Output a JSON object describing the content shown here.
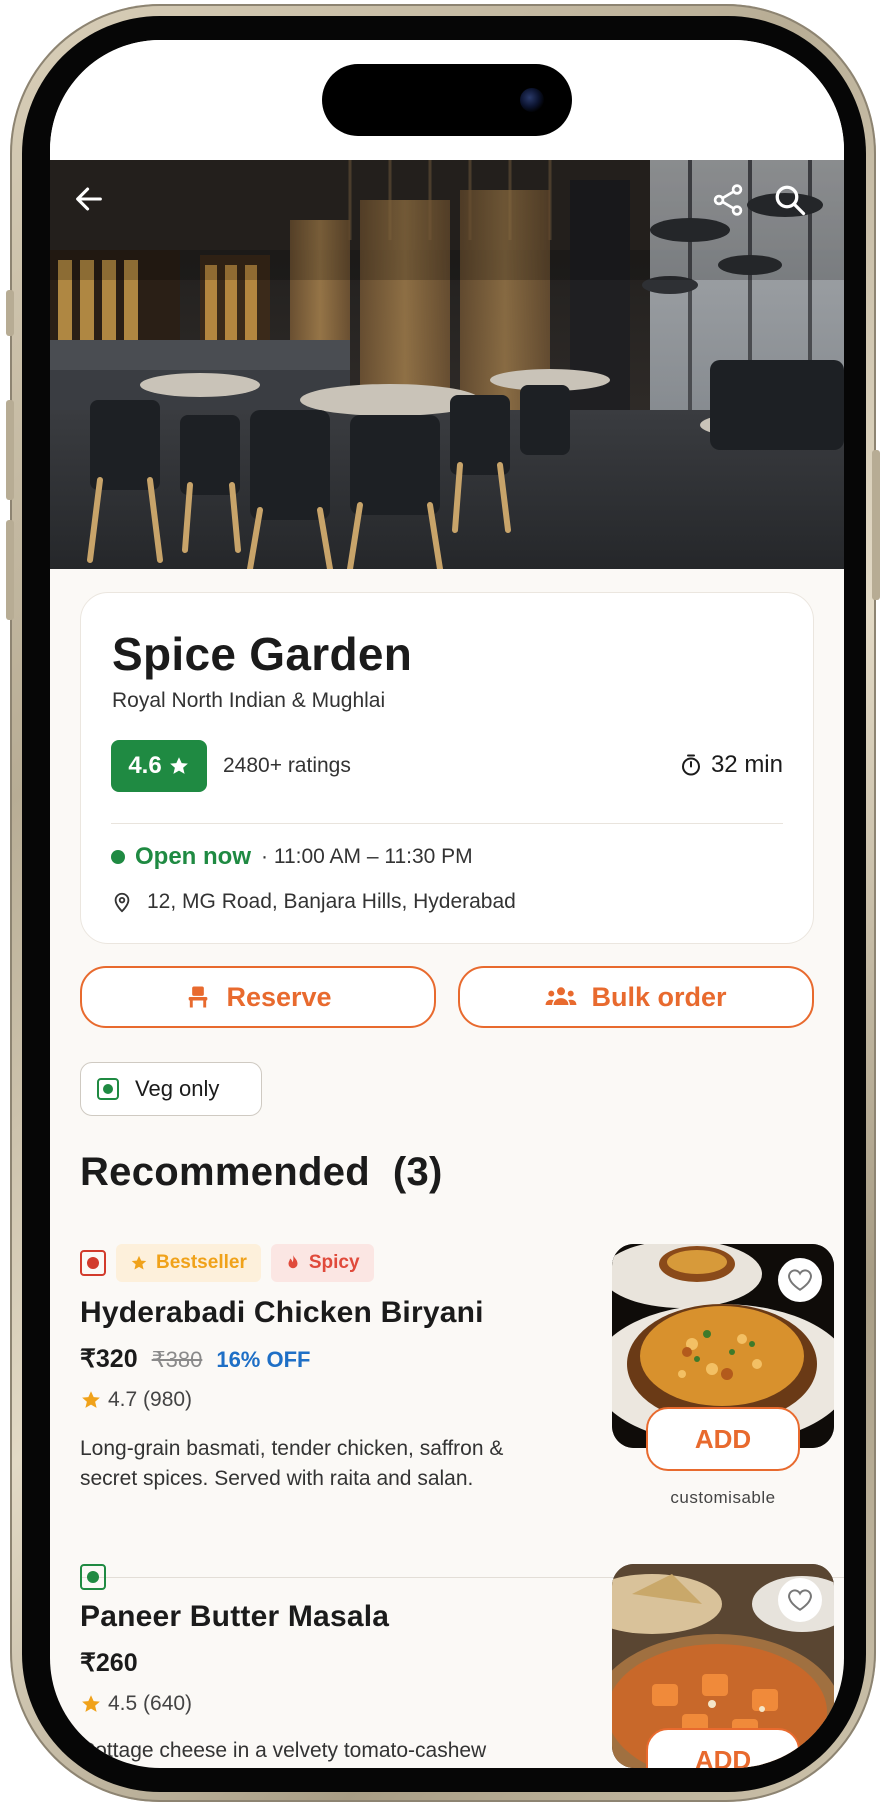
{
  "restaurant": {
    "name": "Spice Garden",
    "cuisine": "Royal North Indian & Mughlai",
    "rating": "4.6",
    "ratings_count": "2480+ ratings",
    "delivery_time": "32 min",
    "status": "Open now",
    "hours": "· 11:00 AM – 11:30 PM",
    "address": "12, MG Road, Banjara Hills, Hyderabad"
  },
  "actions": {
    "reserve": "Reserve",
    "bulk_order": "Bulk order"
  },
  "filters": {
    "veg_only": "Veg only"
  },
  "section": {
    "title": "Recommended",
    "count": "(3)"
  },
  "items": [
    {
      "tag_bestseller": "Bestseller",
      "tag_spicy": "Spicy",
      "name": "Hyderabadi Chicken Biryani",
      "price": "₹320",
      "old_price": "₹380",
      "discount": "16% OFF",
      "rating": "4.7 (980)",
      "description_line1": "Long-grain basmati, tender chicken, saffron &",
      "description_line2": "secret spices. Served with raita and salan.",
      "add_label": "ADD",
      "note": "customisable"
    },
    {
      "name": "Paneer Butter Masala",
      "price": "₹260",
      "rating": "4.5 (640)",
      "description_line1": "Cottage cheese in a velvety tomato-cashew",
      "add_label": "ADD"
    }
  ],
  "colors": {
    "accent": "#e86a2e",
    "veg_green": "#1f8a42",
    "nonveg_red": "#d23b2c",
    "discount_blue": "#1e6fc6",
    "star_yellow": "#f0a21a"
  },
  "icons": {
    "back": "arrow-left-icon",
    "share": "share-icon",
    "search": "search-icon",
    "timer": "timer-icon",
    "location": "location-pin-icon",
    "reserve": "chair-icon",
    "bulk": "group-icon",
    "heart": "heart-icon"
  }
}
